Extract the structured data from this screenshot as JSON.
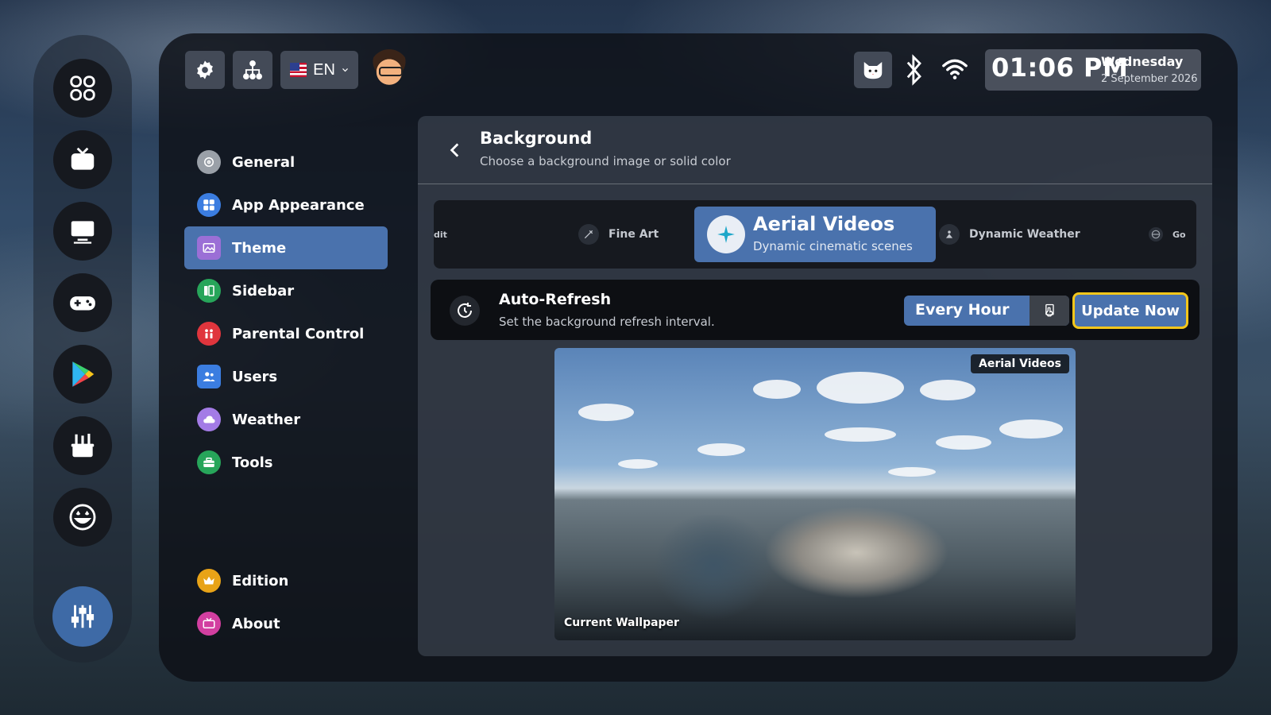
{
  "dock": {
    "items": [
      {
        "icon": "apps-grid-icon"
      },
      {
        "icon": "tv-icon"
      },
      {
        "icon": "monitor-icon"
      },
      {
        "icon": "gamepad-icon"
      },
      {
        "icon": "play-store-icon"
      },
      {
        "icon": "tools-basket-icon"
      },
      {
        "icon": "smiley-icon"
      },
      {
        "icon": "sliders-icon",
        "active": true
      }
    ]
  },
  "topbar": {
    "language": "EN",
    "clock": {
      "time": "01:06 PM",
      "day": "Wednesday",
      "date": "2 September 2026"
    }
  },
  "menu": {
    "items": [
      {
        "label": "General",
        "color": "#9aa0a8"
      },
      {
        "label": "App Appearance",
        "color": "#3b7de0"
      },
      {
        "label": "Theme",
        "color": "#9b6fd6",
        "active": true
      },
      {
        "label": "Sidebar",
        "color": "#27a55a"
      },
      {
        "label": "Parental Control",
        "color": "#e0353d"
      },
      {
        "label": "Users",
        "color": "#3b7de0"
      },
      {
        "label": "Weather",
        "color": "#a37be6"
      },
      {
        "label": "Tools",
        "color": "#27a55a"
      }
    ],
    "bottom": [
      {
        "label": "Edition",
        "color": "#e8a317"
      },
      {
        "label": "About",
        "color": "#d23fa0"
      }
    ]
  },
  "content": {
    "title": "Background",
    "subtitle": "Choose a background image or solid color",
    "carousel": {
      "left_partial": "dit",
      "items": [
        {
          "label": "Fine Art"
        },
        {
          "label": "Dynamic Weather"
        }
      ],
      "right_partial": "Go",
      "active": {
        "title": "Aerial Videos",
        "subtitle": "Dynamic cinematic scenes"
      }
    },
    "refresh": {
      "title": "Auto-Refresh",
      "subtitle": "Set the background refresh interval.",
      "interval": "Every Hour",
      "update_label": "Update Now"
    },
    "preview": {
      "badge": "Aerial Videos",
      "caption": "Current Wallpaper"
    }
  },
  "colors": {
    "accent": "#4a72ad",
    "focus_ring": "#f3c61b"
  }
}
